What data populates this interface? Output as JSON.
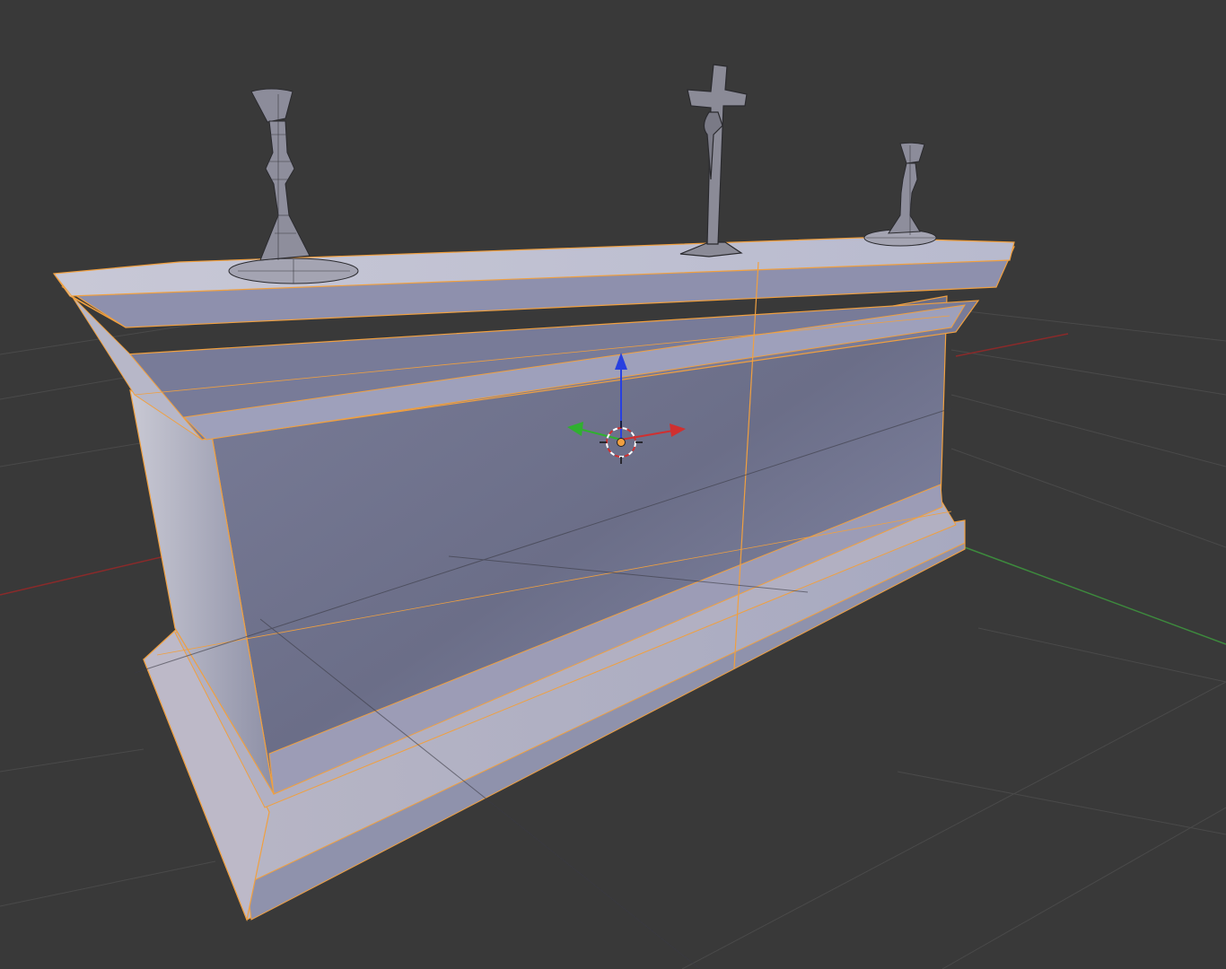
{
  "viewport": {
    "background_color": "#393939",
    "grid_color": "#4a4a4a",
    "axis_x_color": "#8a2a2a",
    "axis_y_color": "#3d8a3d",
    "selection_outline_color": "#f0a040",
    "mesh_face_color": "#8a8fb0",
    "wire_color": "#2a2a2e"
  },
  "scene": {
    "objects": [
      {
        "name": "altar",
        "selected": true,
        "shading": "solid"
      },
      {
        "name": "candlestick-left",
        "selected": false,
        "shading": "wireframe"
      },
      {
        "name": "crucifix",
        "selected": false,
        "shading": "solid"
      },
      {
        "name": "candlestick-right",
        "selected": false,
        "shading": "wireframe"
      }
    ],
    "gizmo": {
      "type": "translate",
      "axes": [
        {
          "axis": "x",
          "color": "#d03030"
        },
        {
          "axis": "y",
          "color": "#30b030"
        },
        {
          "axis": "z",
          "color": "#2840e0"
        }
      ]
    },
    "icons": [
      "3d-cursor-icon",
      "object-origin-icon"
    ]
  }
}
